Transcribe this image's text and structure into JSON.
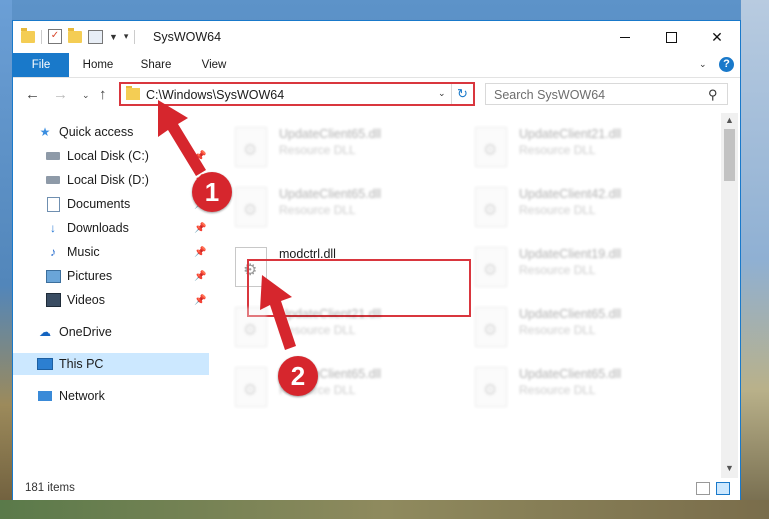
{
  "window": {
    "title": "SysWOW64",
    "accent_color": "#1979ca",
    "highlight_color": "#d9363e"
  },
  "ribbon": {
    "tabs": [
      "File",
      "Home",
      "Share",
      "View"
    ],
    "help_label": "?"
  },
  "navigation": {
    "address_path": "C:\\Windows\\SysWOW64",
    "search_placeholder": "Search SysWOW64"
  },
  "sidebar": {
    "items": [
      {
        "label": "Quick access",
        "icon": "star-icon"
      },
      {
        "label": "Local Disk (C:)",
        "icon": "drive-icon",
        "pinned": true
      },
      {
        "label": "Local Disk (D:)",
        "icon": "drive-icon",
        "pinned": true
      },
      {
        "label": "Documents",
        "icon": "documents-icon",
        "pinned": true
      },
      {
        "label": "Downloads",
        "icon": "download-icon",
        "pinned": true
      },
      {
        "label": "Music",
        "icon": "music-icon",
        "pinned": true
      },
      {
        "label": "Pictures",
        "icon": "pictures-icon",
        "pinned": true
      },
      {
        "label": "Videos",
        "icon": "videos-icon",
        "pinned": true
      },
      {
        "label": "OneDrive",
        "icon": "cloud-icon"
      },
      {
        "label": "This PC",
        "icon": "computer-icon",
        "selected": true
      },
      {
        "label": "Network",
        "icon": "network-icon"
      }
    ]
  },
  "files": [
    {
      "name": "UpdateClient65.dll",
      "type": "Resource DLL"
    },
    {
      "name": "UpdateClient21.dll",
      "type": "Resource DLL"
    },
    {
      "name": "UpdateClient65.dll",
      "type": "Resource DLL"
    },
    {
      "name": "UpdateClient42.dll",
      "type": "Resource DLL"
    },
    {
      "name": "modctrl.dll",
      "type": ""
    },
    {
      "name": "UpdateClient19.dll",
      "type": "Resource DLL"
    },
    {
      "name": "UpdateClient21.dll",
      "type": "Resource DLL"
    },
    {
      "name": "UpdateClient65.dll",
      "type": "Resource DLL"
    },
    {
      "name": "UpdateClient65.dll",
      "type": "Resource DLL"
    },
    {
      "name": "UpdateClient65.dll",
      "type": "Resource DLL"
    }
  ],
  "status": {
    "item_count": "181 items"
  },
  "annotations": {
    "badge1": "1",
    "badge2": "2"
  }
}
